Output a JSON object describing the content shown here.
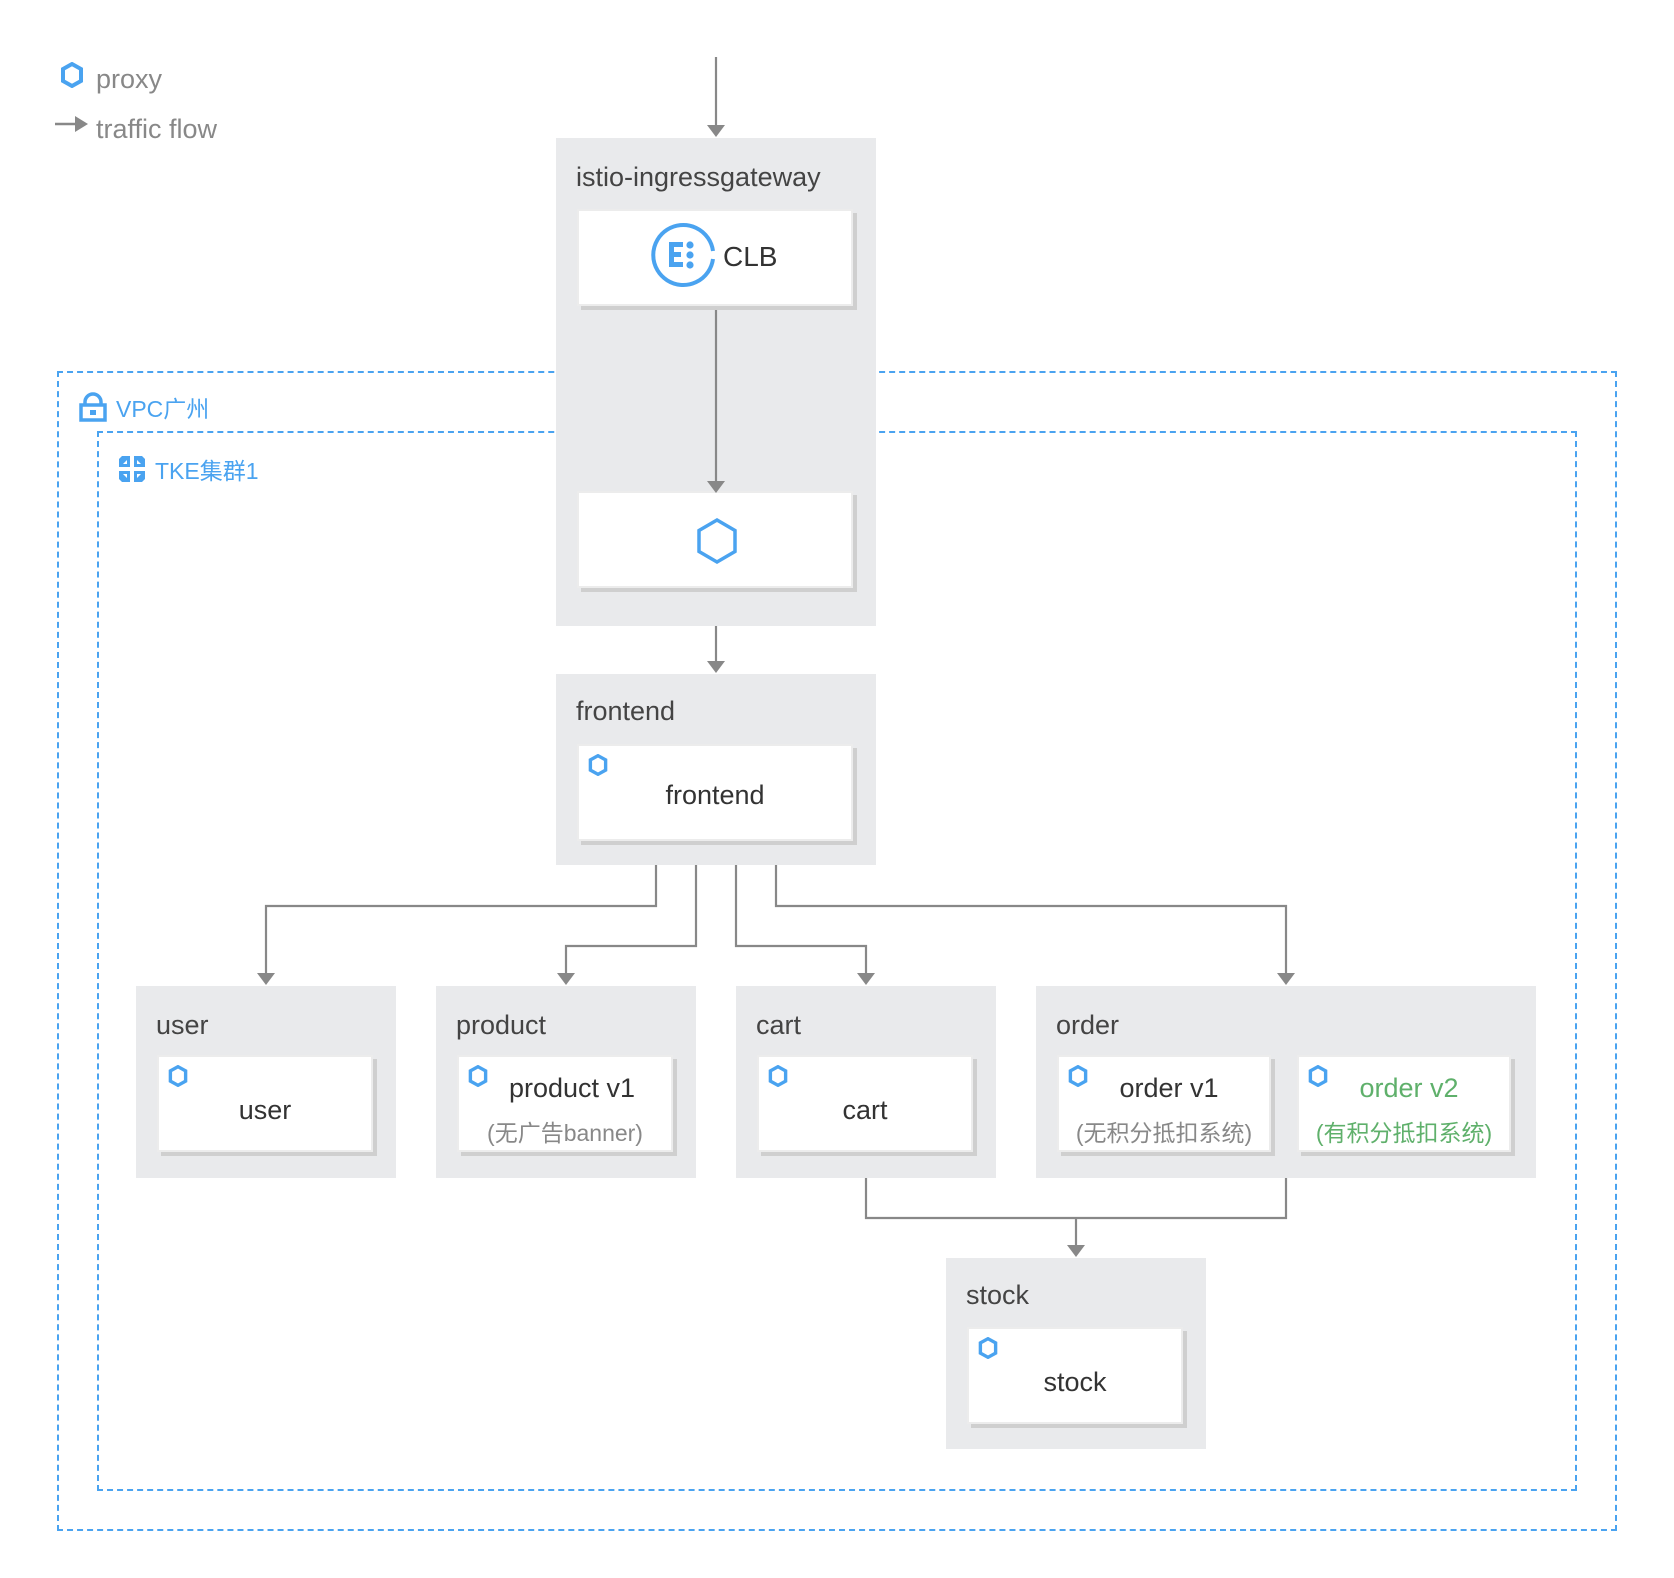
{
  "legend": {
    "proxy_label": "proxy",
    "traffic_label": "traffic flow"
  },
  "zones": {
    "vpc_label": "VPC广州",
    "cluster_label": "TKE集群1"
  },
  "gateway": {
    "title": "istio-ingressgateway",
    "clb_label": "CLB"
  },
  "services": {
    "frontend": {
      "title": "frontend",
      "card": "frontend"
    },
    "user": {
      "title": "user",
      "card": "user"
    },
    "product": {
      "title": "product",
      "card": "product v1",
      "sub": "(无广告banner)"
    },
    "cart": {
      "title": "cart",
      "card": "cart"
    },
    "order": {
      "title": "order",
      "v1": {
        "card": "order v1",
        "sub": "(无积分抵扣系统)"
      },
      "v2": {
        "card": "order v2",
        "sub": "(有积分抵扣系统)"
      }
    },
    "stock": {
      "title": "stock",
      "card": "stock"
    }
  },
  "colors": {
    "accent_blue": "#4aa3f0",
    "highlight_green": "#5fb06b",
    "flow_gray": "#888888",
    "service_bg": "#e9eaec"
  }
}
